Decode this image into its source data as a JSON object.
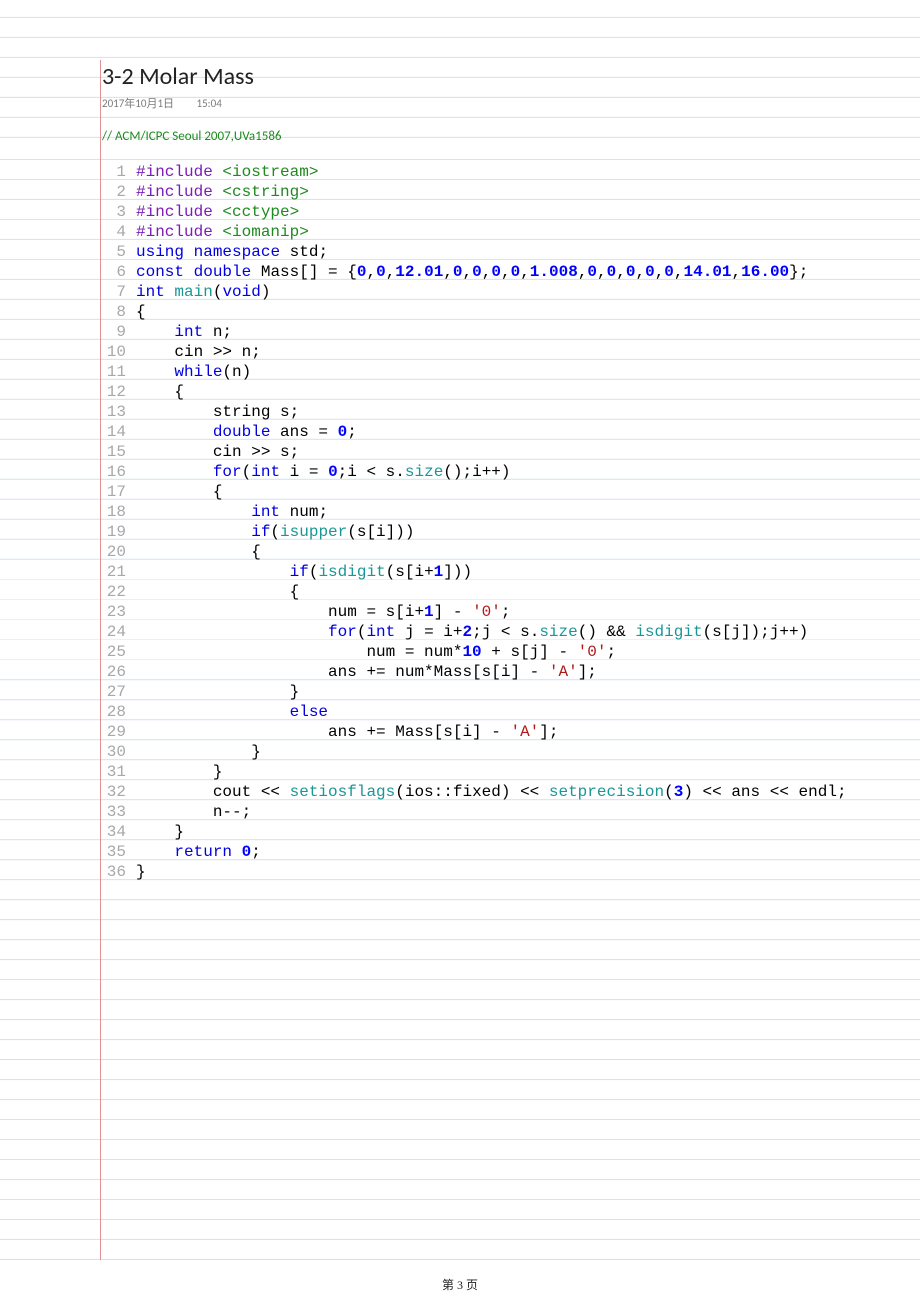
{
  "title": "3-2 Molar Mass",
  "date": "2017年10月1日",
  "time": "15:04",
  "comment": "// ACM/ICPC Seoul 2007,UVa1586",
  "footer": "第 3 页",
  "code": {
    "lines": [
      {
        "n": "1",
        "seg": [
          {
            "c": "pp",
            "t": "#include "
          },
          {
            "c": "ppinc",
            "t": "<iostream>"
          }
        ]
      },
      {
        "n": "2",
        "seg": [
          {
            "c": "pp",
            "t": "#include "
          },
          {
            "c": "ppinc",
            "t": "<cstring>"
          }
        ]
      },
      {
        "n": "3",
        "seg": [
          {
            "c": "pp",
            "t": "#include "
          },
          {
            "c": "ppinc",
            "t": "<cctype>"
          }
        ]
      },
      {
        "n": "4",
        "seg": [
          {
            "c": "pp",
            "t": "#include "
          },
          {
            "c": "ppinc",
            "t": "<iomanip>"
          }
        ]
      },
      {
        "n": "5",
        "seg": [
          {
            "c": "kw",
            "t": "using"
          },
          {
            "t": " "
          },
          {
            "c": "kw",
            "t": "namespace"
          },
          {
            "t": " std;"
          }
        ]
      },
      {
        "n": "6",
        "seg": [
          {
            "c": "kw",
            "t": "const"
          },
          {
            "t": " "
          },
          {
            "c": "kw",
            "t": "double"
          },
          {
            "t": " Mass[] = {"
          },
          {
            "c": "num",
            "t": "0"
          },
          {
            "t": ","
          },
          {
            "c": "num",
            "t": "0"
          },
          {
            "t": ","
          },
          {
            "c": "num",
            "t": "12.01"
          },
          {
            "t": ","
          },
          {
            "c": "num",
            "t": "0"
          },
          {
            "t": ","
          },
          {
            "c": "num",
            "t": "0"
          },
          {
            "t": ","
          },
          {
            "c": "num",
            "t": "0"
          },
          {
            "t": ","
          },
          {
            "c": "num",
            "t": "0"
          },
          {
            "t": ","
          },
          {
            "c": "num",
            "t": "1.008"
          },
          {
            "t": ","
          },
          {
            "c": "num",
            "t": "0"
          },
          {
            "t": ","
          },
          {
            "c": "num",
            "t": "0"
          },
          {
            "t": ","
          },
          {
            "c": "num",
            "t": "0"
          },
          {
            "t": ","
          },
          {
            "c": "num",
            "t": "0"
          },
          {
            "t": ","
          },
          {
            "c": "num",
            "t": "0"
          },
          {
            "t": ","
          },
          {
            "c": "num",
            "t": "14.01"
          },
          {
            "t": ","
          },
          {
            "c": "num",
            "t": "16.00"
          },
          {
            "t": "};"
          }
        ]
      },
      {
        "n": "7",
        "seg": [
          {
            "c": "kw",
            "t": "int"
          },
          {
            "t": " "
          },
          {
            "c": "fn",
            "t": "main"
          },
          {
            "t": "("
          },
          {
            "c": "kw",
            "t": "void"
          },
          {
            "t": ")"
          }
        ]
      },
      {
        "n": "8",
        "seg": [
          {
            "t": "{"
          }
        ]
      },
      {
        "n": "9",
        "seg": [
          {
            "t": "    "
          },
          {
            "c": "kw",
            "t": "int"
          },
          {
            "t": " n;"
          }
        ]
      },
      {
        "n": "10",
        "seg": [
          {
            "t": "    cin >> n;"
          }
        ]
      },
      {
        "n": "11",
        "seg": [
          {
            "t": "    "
          },
          {
            "c": "kw",
            "t": "while"
          },
          {
            "t": "(n)"
          }
        ]
      },
      {
        "n": "12",
        "seg": [
          {
            "t": "    {"
          }
        ]
      },
      {
        "n": "13",
        "seg": [
          {
            "t": "        string s;"
          }
        ]
      },
      {
        "n": "14",
        "seg": [
          {
            "t": "        "
          },
          {
            "c": "kw",
            "t": "double"
          },
          {
            "t": " ans = "
          },
          {
            "c": "num",
            "t": "0"
          },
          {
            "t": ";"
          }
        ]
      },
      {
        "n": "15",
        "seg": [
          {
            "t": "        cin >> s;"
          }
        ]
      },
      {
        "n": "16",
        "seg": [
          {
            "t": "        "
          },
          {
            "c": "kw",
            "t": "for"
          },
          {
            "t": "("
          },
          {
            "c": "kw",
            "t": "int"
          },
          {
            "t": " i = "
          },
          {
            "c": "num",
            "t": "0"
          },
          {
            "t": ";i < s."
          },
          {
            "c": "fn",
            "t": "size"
          },
          {
            "t": "();i++)"
          }
        ]
      },
      {
        "n": "17",
        "seg": [
          {
            "t": "        {"
          }
        ]
      },
      {
        "n": "18",
        "seg": [
          {
            "t": "            "
          },
          {
            "c": "kw",
            "t": "int"
          },
          {
            "t": " num;"
          }
        ]
      },
      {
        "n": "19",
        "seg": [
          {
            "t": "            "
          },
          {
            "c": "kw",
            "t": "if"
          },
          {
            "t": "("
          },
          {
            "c": "fn",
            "t": "isupper"
          },
          {
            "t": "(s[i]))"
          }
        ]
      },
      {
        "n": "20",
        "seg": [
          {
            "t": "            {"
          }
        ]
      },
      {
        "n": "21",
        "seg": [
          {
            "t": "                "
          },
          {
            "c": "kw",
            "t": "if"
          },
          {
            "t": "("
          },
          {
            "c": "fn",
            "t": "isdigit"
          },
          {
            "t": "(s[i+"
          },
          {
            "c": "num",
            "t": "1"
          },
          {
            "t": "]))"
          }
        ]
      },
      {
        "n": "22",
        "seg": [
          {
            "t": "                {"
          }
        ]
      },
      {
        "n": "23",
        "seg": [
          {
            "t": "                    num = s[i+"
          },
          {
            "c": "num",
            "t": "1"
          },
          {
            "t": "] - "
          },
          {
            "c": "str",
            "t": "'0'"
          },
          {
            "t": ";"
          }
        ]
      },
      {
        "n": "24",
        "seg": [
          {
            "t": "                    "
          },
          {
            "c": "kw",
            "t": "for"
          },
          {
            "t": "("
          },
          {
            "c": "kw",
            "t": "int"
          },
          {
            "t": " j = i+"
          },
          {
            "c": "num",
            "t": "2"
          },
          {
            "t": ";j < s."
          },
          {
            "c": "fn",
            "t": "size"
          },
          {
            "t": "() && "
          },
          {
            "c": "fn",
            "t": "isdigit"
          },
          {
            "t": "(s[j]);j++)"
          }
        ]
      },
      {
        "n": "25",
        "seg": [
          {
            "t": "                        num = num*"
          },
          {
            "c": "num",
            "t": "10"
          },
          {
            "t": " + s[j] - "
          },
          {
            "c": "str",
            "t": "'0'"
          },
          {
            "t": ";"
          }
        ]
      },
      {
        "n": "26",
        "seg": [
          {
            "t": "                    ans += num*Mass[s[i] - "
          },
          {
            "c": "str",
            "t": "'A'"
          },
          {
            "t": "];"
          }
        ]
      },
      {
        "n": "27",
        "seg": [
          {
            "t": "                }"
          }
        ]
      },
      {
        "n": "28",
        "seg": [
          {
            "t": "                "
          },
          {
            "c": "kw",
            "t": "else"
          }
        ]
      },
      {
        "n": "29",
        "seg": [
          {
            "t": "                    ans += Mass[s[i] - "
          },
          {
            "c": "str",
            "t": "'A'"
          },
          {
            "t": "];"
          }
        ]
      },
      {
        "n": "30",
        "seg": [
          {
            "t": "            }"
          }
        ]
      },
      {
        "n": "31",
        "seg": [
          {
            "t": "        }"
          }
        ]
      },
      {
        "n": "32",
        "seg": [
          {
            "t": "        cout << "
          },
          {
            "c": "fn",
            "t": "setiosflags"
          },
          {
            "t": "(ios::fixed) << "
          },
          {
            "c": "fn",
            "t": "setprecision"
          },
          {
            "t": "("
          },
          {
            "c": "num",
            "t": "3"
          },
          {
            "t": ") << ans << endl;"
          }
        ]
      },
      {
        "n": "33",
        "seg": [
          {
            "t": "        n--;"
          }
        ]
      },
      {
        "n": "34",
        "seg": [
          {
            "t": "    }"
          }
        ]
      },
      {
        "n": "35",
        "seg": [
          {
            "t": "    "
          },
          {
            "c": "kw",
            "t": "return"
          },
          {
            "t": " "
          },
          {
            "c": "num",
            "t": "0"
          },
          {
            "t": ";"
          }
        ]
      },
      {
        "n": "36",
        "seg": [
          {
            "t": "}"
          }
        ]
      }
    ]
  }
}
